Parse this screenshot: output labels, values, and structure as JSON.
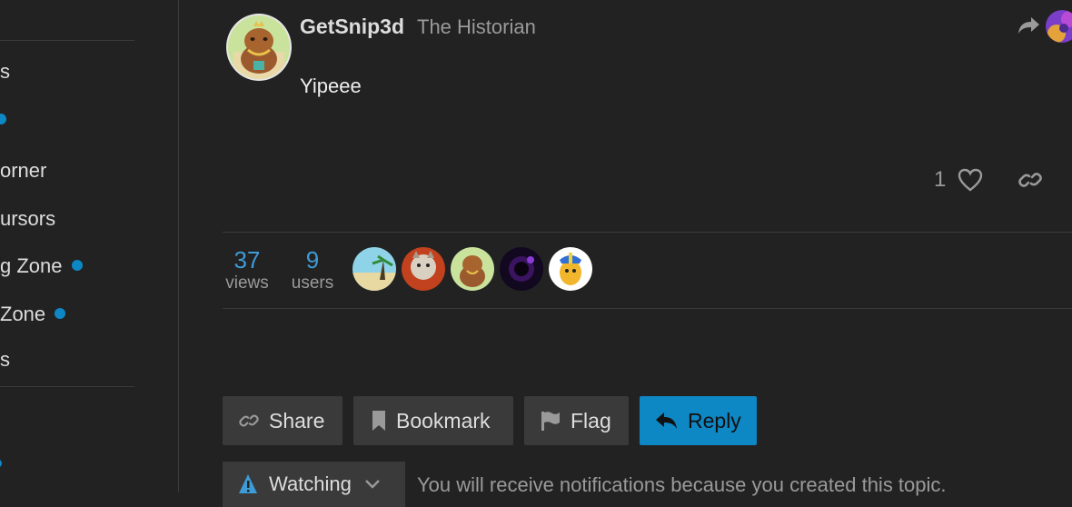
{
  "sidebar": {
    "items": [
      {
        "label": "s",
        "dot": false
      },
      {
        "label": "",
        "dot": true
      },
      {
        "label": "orner",
        "dot": false
      },
      {
        "label": "ursors",
        "dot": false
      },
      {
        "label": "g Zone",
        "dot": true
      },
      {
        "label": "Zone",
        "dot": true
      },
      {
        "label": "s",
        "dot": false
      }
    ]
  },
  "post": {
    "username": "GetSnip3d",
    "user_title": "The Historian",
    "body": "Yipeee",
    "like_count": "1"
  },
  "topic_stats": {
    "views_count": "37",
    "views_label": "views",
    "users_count": "9",
    "users_label": "users"
  },
  "actions": {
    "share": "Share",
    "bookmark": "Bookmark",
    "flag": "Flag",
    "reply": "Reply"
  },
  "notifications": {
    "button_label": "Watching",
    "text": "You will receive notifications because you created this topic."
  },
  "colors": {
    "background": "#222222",
    "accent": "#0e87c5",
    "stat_number": "#3e9bd6",
    "muted_text": "#9a9a9a",
    "button_bg": "#3a3a3a"
  }
}
